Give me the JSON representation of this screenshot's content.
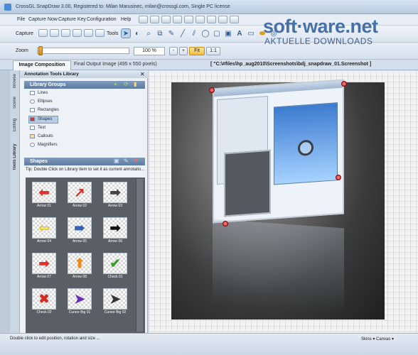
{
  "window": {
    "title": "CrossGL SnapDraw 3.00, Registered to: Milan Marusinec, milan@crossgl.com, Single PC license"
  },
  "watermark": {
    "logo": "soft·ware.net",
    "subtitle": "AKTUELLE DOWNLOADS"
  },
  "menu": {
    "items": [
      "File",
      "Capture Now",
      "Capture Key",
      "Configuration",
      "Help"
    ]
  },
  "toolbar": {
    "capture_label": "Capture",
    "tools_label": "Tools",
    "zoom_label": "Zoom",
    "zoom_value": "100 %",
    "zoom_minus": "-",
    "zoom_plus": "+",
    "fit_label": "Fit",
    "one_to_one_label": "1:1",
    "zoom_level_fraction": 0.02
  },
  "tabs": {
    "composition": "Image Composition",
    "final": "Final Output Image (495 x 550 pixels)",
    "path": "[ \"C:\\#files\\hp_aug2010\\Screenshots\\bdj_snapdraw_01.Screenshot ]"
  },
  "side_tabs": [
    "Tools Library",
    "Editing",
    "Scene",
    "Browse"
  ],
  "library": {
    "title": "Annotation Tools Library",
    "groups_header": "Library Groups",
    "groups": [
      "Lines",
      "Ellipses",
      "Rectangles",
      "Shapes",
      "Text",
      "Callouts",
      "Magnifiers"
    ],
    "selected_group": "Shapes",
    "shapes_header": "Shapes",
    "tip": "Tip: Double Click on Library item to set it as current annotatio...",
    "shapes": [
      {
        "label": "Arrow 01",
        "glyph": "⬅",
        "color": "#e0332a"
      },
      {
        "label": "Arrow 02",
        "glyph": "↗",
        "color": "#d8291f"
      },
      {
        "label": "Arrow 03",
        "glyph": "➡",
        "color": "#444444"
      },
      {
        "label": "Arrow 04",
        "glyph": "⇦",
        "color": "#e8c21c"
      },
      {
        "label": "Arrow 05",
        "glyph": "➠",
        "color": "#2f5fb7"
      },
      {
        "label": "Arrow 06",
        "glyph": "➡",
        "color": "#111111"
      },
      {
        "label": "Arrow 07",
        "glyph": "➡",
        "color": "#e0332a"
      },
      {
        "label": "Arrow 08",
        "glyph": "⬆",
        "color": "#ef8a1a"
      },
      {
        "label": "Check 01",
        "glyph": "✔",
        "color": "#3a9c2a"
      },
      {
        "label": "Check 02",
        "glyph": "✖",
        "color": "#d42a20"
      },
      {
        "label": "Cursor Big 01",
        "glyph": "➤",
        "color": "#6a2db8"
      },
      {
        "label": "Cursor Big 02",
        "glyph": "➤",
        "color": "#333333"
      }
    ]
  },
  "status": {
    "text": "Double click to edit position, rotation and size ...",
    "right": "Skins ▾  Canvas ▾"
  }
}
